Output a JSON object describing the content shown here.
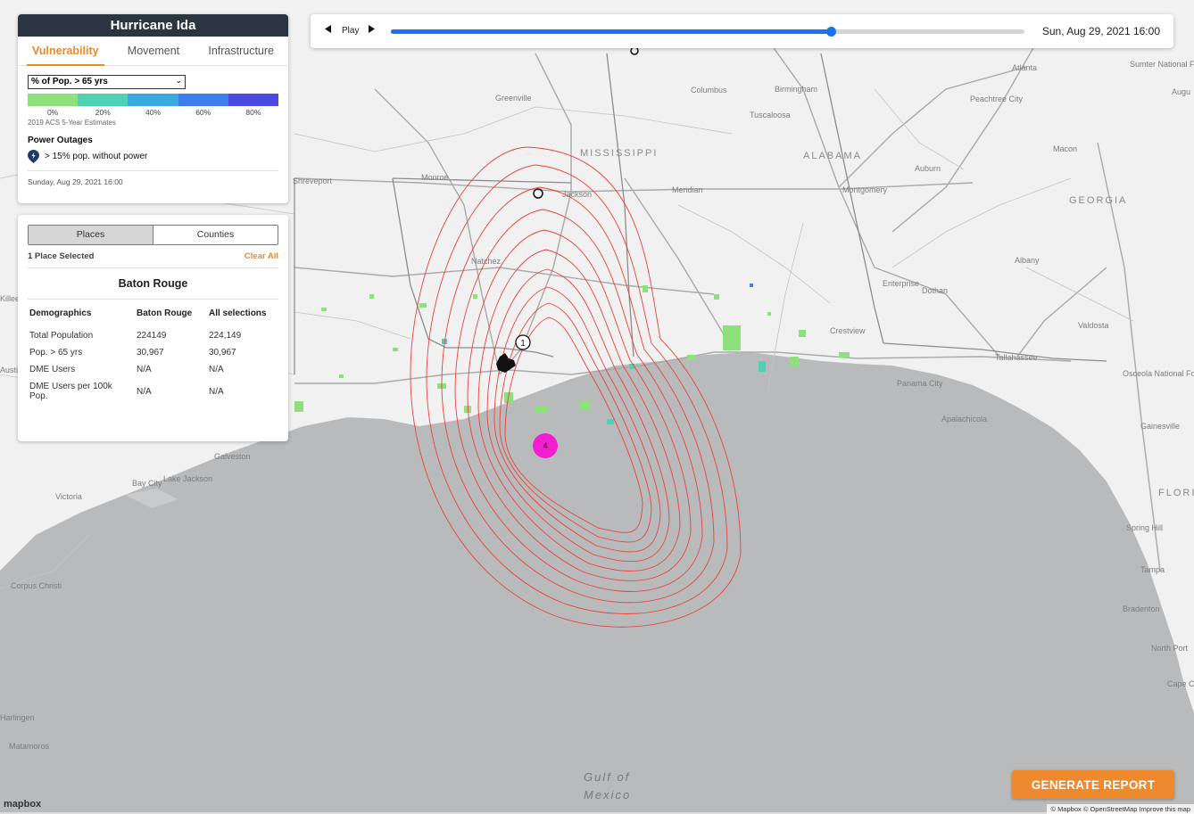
{
  "legend": {
    "title": "Hurricane Ida",
    "tabs": [
      "Vulnerability",
      "Movement",
      "Infrastructure"
    ],
    "active_tab": "Vulnerability",
    "metric_select": "% of Pop. > 65 yrs",
    "ramp_colors": [
      "#8ee07f",
      "#4fd1b4",
      "#38a9e3",
      "#3c7ef0",
      "#4a49e6"
    ],
    "ramp_labels": [
      "0%",
      "20%",
      "40%",
      "60%",
      "80%"
    ],
    "source": "2019 ACS 5-Year Estimates",
    "outages_title": "Power Outages",
    "outages_label": "> 15% pop. without power",
    "timestamp": "Sunday, Aug 29, 2021 16:00"
  },
  "places": {
    "segments": [
      "Places",
      "Counties"
    ],
    "selected_count": "1 Place Selected",
    "clear_all": "Clear All",
    "place_name": "Baton Rouge",
    "columns": [
      "Demographics",
      "Baton Rouge",
      "All selections"
    ],
    "rows": [
      [
        "Total Population",
        "224149",
        "224,149"
      ],
      [
        "Pop. > 65 yrs",
        "30,967",
        "30,967"
      ],
      [
        "DME Users",
        "N/A",
        "N/A"
      ],
      [
        "DME Users per 100k Pop.",
        "N/A",
        "N/A"
      ]
    ]
  },
  "player": {
    "back_icon": "step-back-icon",
    "play_label": "Play",
    "forward_icon": "step-forward-icon",
    "progress": 0.695,
    "date": "Sun, Aug 29, 2021 16:00"
  },
  "map": {
    "states": [
      "MISSISSIPPI",
      "ALABAMA",
      "GEORGIA",
      "FLORI"
    ],
    "cities": [
      "Atlanta",
      "Birmingham",
      "Columbus",
      "Tuscaloosa",
      "Greenville",
      "Jackson",
      "Meridian",
      "Montgomery",
      "Auburn",
      "Macon",
      "Shreveport",
      "Monroe",
      "Natchez",
      "Albany",
      "Enterprise",
      "Dothan",
      "Crestview",
      "Tallahassee",
      "Panama City",
      "Apalachicola",
      "Gainesville",
      "Sumter National Forest",
      "Peachtree City",
      "Osceola National Forest",
      "Galveston",
      "Lake Jackson",
      "Bay City",
      "Victoria",
      "Corpus Christi",
      "Harlingen",
      "Matamoros",
      "Spring Hill",
      "Tampa",
      "Bradenton",
      "North Port",
      "Cape C",
      "Valdosta",
      "Killeen",
      "Austin",
      "Augu"
    ],
    "water_label": "Gulf of Mexico",
    "storm_markers": [
      "1",
      "4"
    ],
    "marker_color": "#f21fd0",
    "contour_color": "#e8423b"
  },
  "actions": {
    "generate_report": "GENERATE REPORT"
  },
  "footer": {
    "logo": "mapbox",
    "attribution": "© Mapbox © OpenStreetMap Improve this map"
  }
}
